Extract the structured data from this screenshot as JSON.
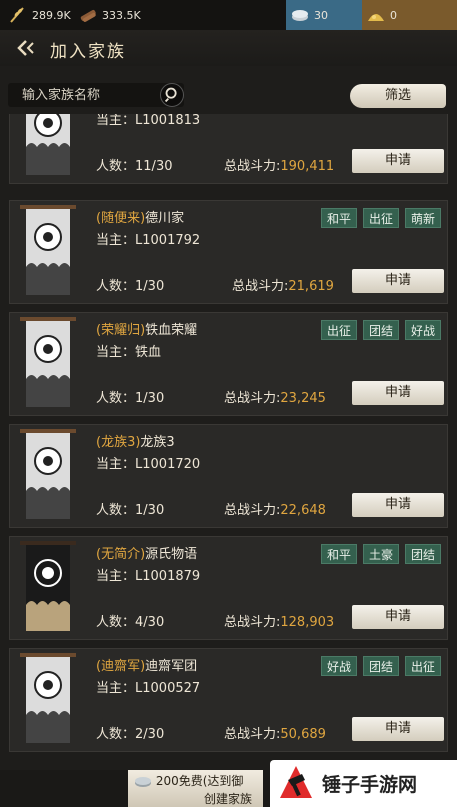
{
  "resources": {
    "grain": "289.9K",
    "wood": "333.5K",
    "silver": "30",
    "gold": "0"
  },
  "header": {
    "title": "加入家族"
  },
  "search": {
    "placeholder": "输入家族名称",
    "filter_label": "筛选"
  },
  "labels": {
    "leader_prefix": "当主：",
    "members_prefix": "人数：",
    "power_prefix": "总战斗力:",
    "apply": "申请"
  },
  "clans": [
    {
      "tag": "",
      "name": "",
      "leader": "L1001813",
      "members": "11/30",
      "power": "190,411",
      "tags": [],
      "banner": "grey"
    },
    {
      "tag": "(随便来)",
      "name": "德川家",
      "leader": "L1001792",
      "members": "1/30",
      "power": "21,619",
      "tags": [
        "和平",
        "出征",
        "萌新"
      ],
      "banner": "grey"
    },
    {
      "tag": "(荣耀归)",
      "name": "铁血荣耀",
      "leader": "铁血",
      "members": "1/30",
      "power": "23,245",
      "tags": [
        "出征",
        "团结",
        "好战"
      ],
      "banner": "grey"
    },
    {
      "tag": "(龙族3)",
      "name": "龙族3",
      "leader": "L1001720",
      "members": "1/30",
      "power": "22,648",
      "tags": [],
      "banner": "grey"
    },
    {
      "tag": "(无简介)",
      "name": "源氏物语",
      "leader": "L1001879",
      "members": "4/30",
      "power": "128,903",
      "tags": [
        "和平",
        "土豪",
        "团结"
      ],
      "banner": "dark"
    },
    {
      "tag": "(迪齋军)",
      "name": "迪齋军团",
      "leader": "L1000527",
      "members": "2/30",
      "power": "50,689",
      "tags": [
        "好战",
        "团结",
        "出征"
      ],
      "banner": "grey"
    }
  ],
  "footer": {
    "create_cost": "200",
    "create_note": "免费(达到御",
    "create_label": "创建家族"
  },
  "watermark": {
    "text": "锤子手游网"
  }
}
